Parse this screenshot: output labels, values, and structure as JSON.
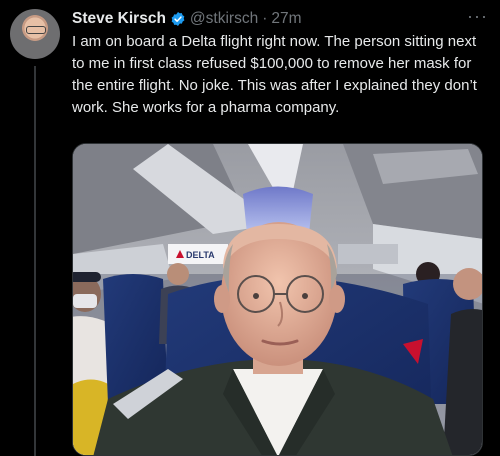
{
  "tweet": {
    "author_name": "Steve Kirsch",
    "handle": "@stkirsch",
    "separator": "·",
    "time": "27m",
    "more_label": "···",
    "text": "I am on board a Delta flight right now. The person sitting next to me in first class refused $100,000 to remove her mask for the entire flight. No joke. This was after I explained they don’t work. She works for a pharma company.",
    "verified": true
  },
  "media": {
    "airline_sign": "DELTA"
  },
  "colors": {
    "background": "#000000",
    "text": "#e7e9ea",
    "secondary": "#71767b",
    "verified_badge": "#1d9bf0"
  }
}
